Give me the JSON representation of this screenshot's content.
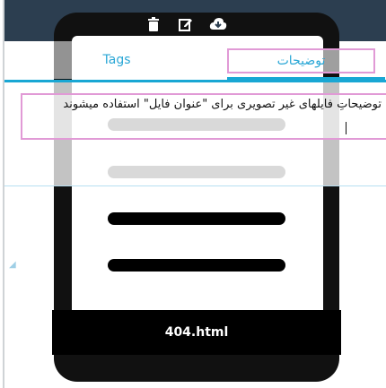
{
  "toolbar": {
    "icons": [
      "trash-icon",
      "edit-icon",
      "cloud-download-icon"
    ]
  },
  "tabs": [
    {
      "label": "Tags"
    },
    {
      "label": "توضیحات"
    }
  ],
  "description": {
    "text": "توضیحاتِ فایلهای غیر تصویری برای \"عنوان فایل\" استفاده میشوند"
  },
  "file": {
    "name": "404.html"
  },
  "colors": {
    "header": "#2c3e50",
    "accent": "#19a7d4",
    "highlight": "#e19ad6",
    "file_icon": "#000000"
  }
}
